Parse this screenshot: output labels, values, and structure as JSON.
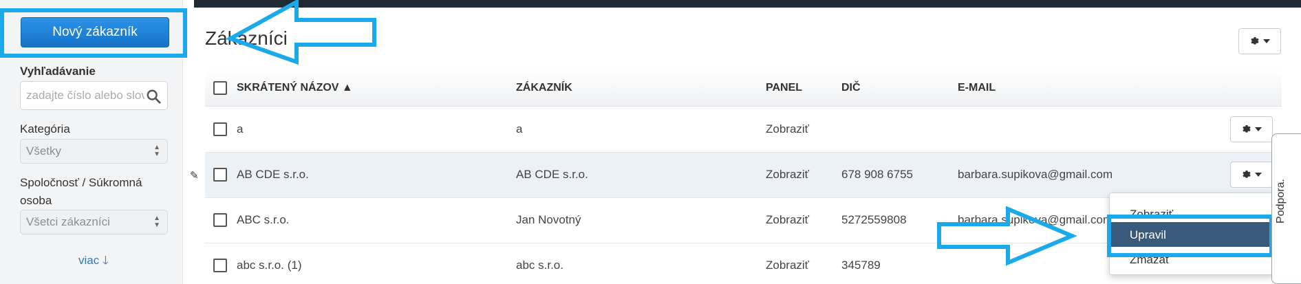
{
  "sidebar": {
    "new_customer_button": "Nový zákazník",
    "search_label": "Vyhľadávanie",
    "search_placeholder": "zadajte číslo alebo slovo",
    "category_label": "Kategória",
    "category_value": "Všetky",
    "company_label_line1": "Spoločnosť / Súkromná",
    "company_label_line2": "osoba",
    "company_value": "Všetci zákazníci",
    "more_link": "viac 🡓"
  },
  "main": {
    "title": "Zákazníci"
  },
  "table": {
    "headers": {
      "short_name": "SKRÁTENÝ NÁZOV ▲",
      "customer": "ZÁKAZNÍK",
      "panel": "PANEL",
      "dic": "DIČ",
      "email": "E-MAIL"
    },
    "rows": [
      {
        "short_name": "a",
        "customer": "a",
        "panel": "Zobraziť",
        "dic": "",
        "email": ""
      },
      {
        "short_name": "AB CDE s.r.o.",
        "customer": "AB CDE s.r.o.",
        "panel": "Zobraziť",
        "dic": "678 908 6755",
        "email": "barbara.supikova@gmail.com"
      },
      {
        "short_name": "ABC s.r.o.",
        "customer": "Jan Novotný",
        "panel": "Zobraziť",
        "dic": "5272559808",
        "email": "barbara.supikova@gmail.com"
      },
      {
        "short_name": "abc s.r.o. (1)",
        "customer": "abc s.r.o.",
        "panel": "Zobraziť",
        "dic": "345789",
        "email": ""
      }
    ]
  },
  "row_menu": {
    "items": [
      "Zobraziť",
      "Upravil",
      "Zmazať"
    ]
  },
  "support_tab": "Podpora.",
  "colors": {
    "highlight": "#1aa9ea",
    "primary_button": "#1e82d8",
    "active_menu": "#3a5a7c",
    "link": "#2a7bc4"
  }
}
